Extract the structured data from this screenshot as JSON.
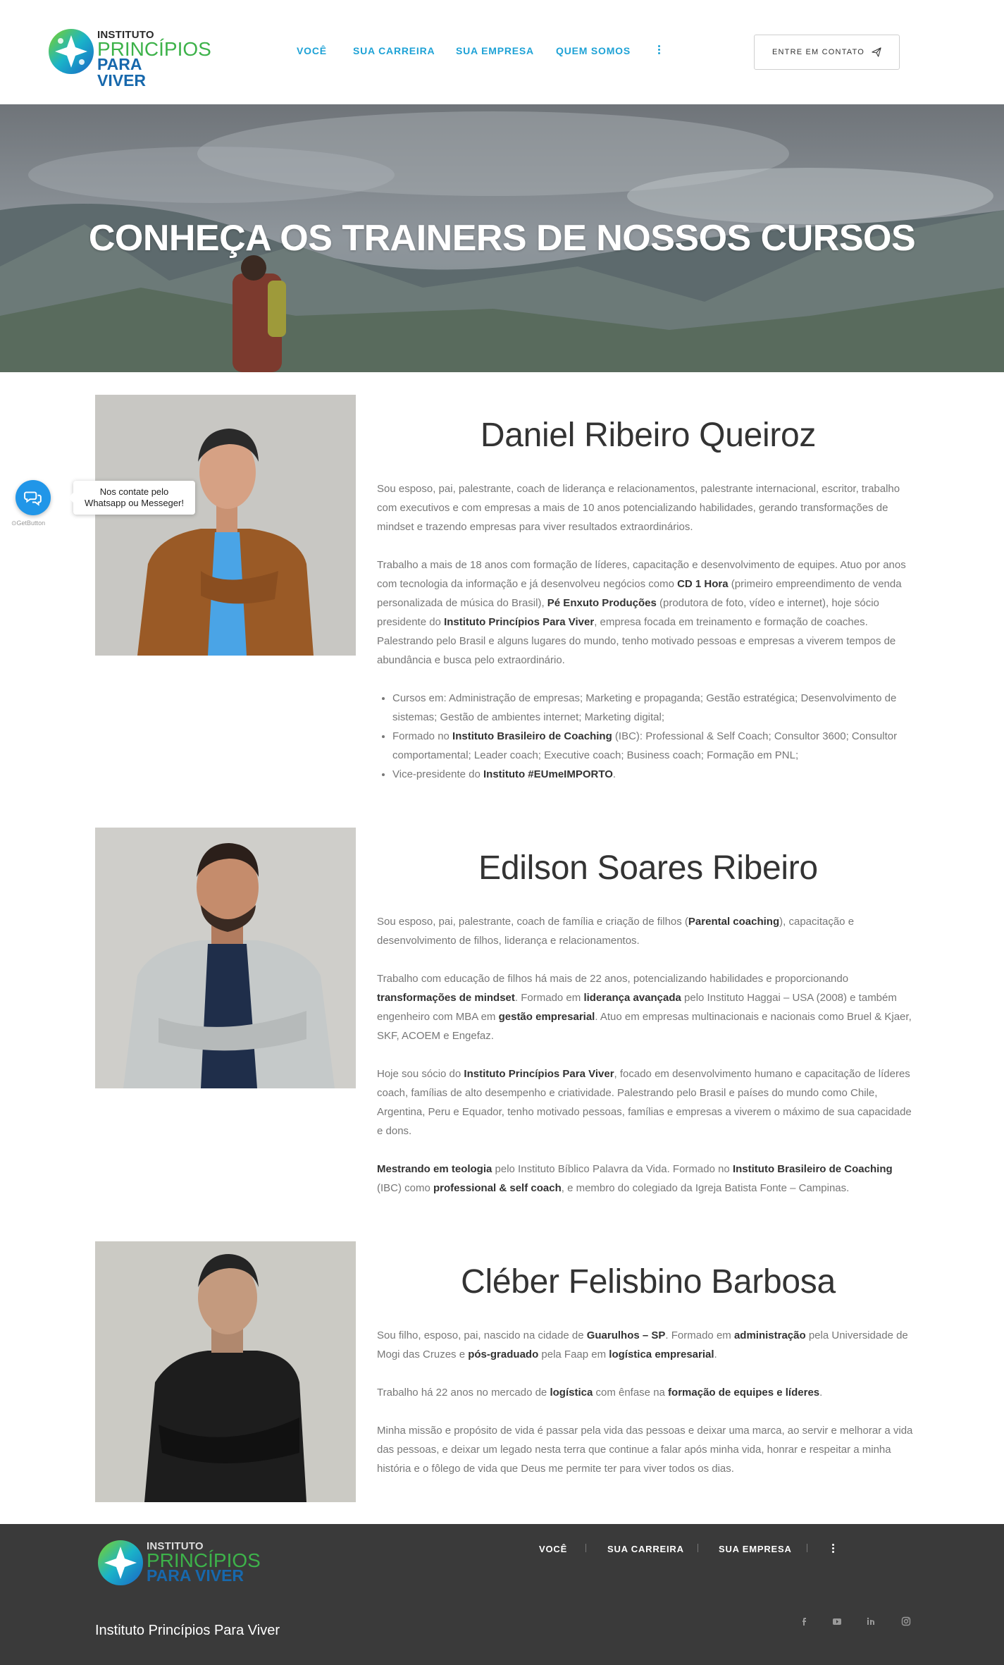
{
  "header": {
    "logo": {
      "line1": "INSTITUTO",
      "line2": "PRINCÍPIOS",
      "line3": "PARA VIVER"
    },
    "nav": [
      {
        "label": "VOCÊ"
      },
      {
        "label": "SUA CARREIRA"
      },
      {
        "label": "SUA EMPRESA"
      },
      {
        "label": "QUEM SOMOS"
      }
    ],
    "more_icon": "vertical-dots-icon",
    "contact_button": "ENTRE EM CONTATO",
    "contact_icon": "paper-plane-icon"
  },
  "hero": {
    "title": "CONHEÇA OS TRAINERS DE NOSSOS CURSOS"
  },
  "widget": {
    "tooltip_line1": "Nos contate pelo",
    "tooltip_line2": "Whatsapp ou Messeger!",
    "brand": "GetButton",
    "color": "#2196e8"
  },
  "trainers": [
    {
      "name": "Daniel Ribeiro Queiroz",
      "paragraphs": [
        [
          {
            "t": "Sou esposo, pai, palestrante, coach de liderança e relacionamentos, palestrante internacional, escritor, trabalho com executivos e com empresas a mais de 10 anos potencializando habilidades, gerando transformações de mindset e trazendo empresas para viver resultados extraordinários."
          }
        ],
        [
          {
            "t": "Trabalho a mais de 18 anos com formação de líderes, capacitação e desenvolvimento de equipes. Atuo por anos com tecnologia da informação e já desenvolveu negócios como "
          },
          {
            "t": "CD 1 Hora",
            "b": true
          },
          {
            "t": " (primeiro empreendimento de venda personalizada de música do Brasil), "
          },
          {
            "t": "Pé Enxuto Produções",
            "b": true
          },
          {
            "t": " (produtora de foto, vídeo e internet), hoje sócio presidente do "
          },
          {
            "t": "Instituto Princípios Para Viver",
            "b": true
          },
          {
            "t": ", empresa focada em treinamento e formação de coaches. Palestrando pelo Brasil e alguns lugares do mundo, tenho motivado pessoas e empresas a viverem tempos de abundância e busca pelo extraordinário."
          }
        ]
      ],
      "bullets": [
        [
          {
            "t": "Cursos em: Administração de empresas; Marketing e propaganda; Gestão estratégica; Desenvolvimento de sistemas; Gestão de ambientes internet; Marketing digital;"
          }
        ],
        [
          {
            "t": "Formado no "
          },
          {
            "t": "Instituto Brasileiro de Coaching",
            "b": true
          },
          {
            "t": " (IBC): Professional & Self Coach; Consultor 3600; Consultor comportamental; Leader coach; Executive coach; Business coach; Formação em PNL;"
          }
        ],
        [
          {
            "t": "Vice-presidente do "
          },
          {
            "t": "Instituto #EUmeIMPORTO",
            "b": true
          },
          {
            "t": "."
          }
        ]
      ]
    },
    {
      "name": "Edilson Soares Ribeiro",
      "paragraphs": [
        [
          {
            "t": "Sou esposo, pai, palestrante, coach de família e criação de filhos ("
          },
          {
            "t": "Parental coaching",
            "b": true
          },
          {
            "t": "), capacitação e desenvolvimento de filhos, liderança e relacionamentos."
          }
        ],
        [
          {
            "t": "Trabalho com educação de filhos há mais de 22 anos, potencializando habilidades e proporcionando "
          },
          {
            "t": "transformações de mindset",
            "b": true
          },
          {
            "t": ". Formado em "
          },
          {
            "t": "liderança avançada",
            "b": true
          },
          {
            "t": " pelo Instituto Haggai – USA (2008) e também engenheiro com MBA em "
          },
          {
            "t": "gestão empresarial",
            "b": true
          },
          {
            "t": ". Atuo em empresas multinacionais e nacionais como Bruel & Kjaer, SKF, ACOEM e Engefaz."
          }
        ],
        [
          {
            "t": "Hoje sou sócio do "
          },
          {
            "t": "Instituto Princípios Para Viver",
            "b": true
          },
          {
            "t": ", focado em desenvolvimento humano e capacitação de líderes coach, famílias de alto desempenho e criatividade. Palestrando pelo Brasil e países do mundo como Chile, Argentina, Peru e Equador, tenho motivado pessoas, famílias e empresas a viverem o máximo de sua capacidade e dons."
          }
        ],
        [
          {
            "t": "Mestrando em teologia",
            "b": true
          },
          {
            "t": " pelo Instituto Bíblico Palavra da Vida. Formado no "
          },
          {
            "t": "Instituto Brasileiro de Coaching",
            "b": true
          },
          {
            "t": " (IBC) como "
          },
          {
            "t": "professional & self coach",
            "b": true
          },
          {
            "t": ", e membro do colegiado da Igreja Batista Fonte – Campinas."
          }
        ]
      ],
      "bullets": []
    },
    {
      "name": "Cléber Felisbino Barbosa",
      "paragraphs": [
        [
          {
            "t": "Sou filho, esposo, pai, nascido na cidade de "
          },
          {
            "t": "Guarulhos – SP",
            "b": true
          },
          {
            "t": ". Formado em "
          },
          {
            "t": "administração",
            "b": true
          },
          {
            "t": " pela Universidade de Mogi das Cruzes e "
          },
          {
            "t": "pós-graduado",
            "b": true
          },
          {
            "t": " pela Faap em "
          },
          {
            "t": "logística empresarial",
            "b": true
          },
          {
            "t": "."
          }
        ],
        [
          {
            "t": "Trabalho há 22 anos no mercado de "
          },
          {
            "t": "logística",
            "b": true
          },
          {
            "t": " com ênfase na "
          },
          {
            "t": "formação de equipes e líderes",
            "b": true
          },
          {
            "t": "."
          }
        ],
        [
          {
            "t": "Minha missão e propósito de vida é passar pela vida das pessoas e deixar uma marca, ao servir e melhorar a vida das pessoas, e deixar um legado nesta terra que continue a falar após minha vida, honrar e respeitar a minha história e o fôlego de vida que Deus me permite ter para viver todos os dias."
          }
        ]
      ],
      "bullets": []
    }
  ],
  "footer": {
    "logo": {
      "line1": "INSTITUTO",
      "line2": "PRINCÍPIOS",
      "line3": "PARA VIVER"
    },
    "nav": [
      {
        "label": "VOCÊ"
      },
      {
        "label": "SUA CARREIRA"
      },
      {
        "label": "SUA EMPRESA"
      }
    ],
    "more_icon": "vertical-dots-icon",
    "site_name": "Instituto Princípios Para Viver",
    "social": [
      "facebook-icon",
      "youtube-icon",
      "linkedin-icon",
      "instagram-icon"
    ]
  },
  "colors": {
    "accent": "#1ea2d6",
    "heading": "#333333",
    "body_text": "#777777",
    "footer_bg": "#3a3a3a"
  }
}
